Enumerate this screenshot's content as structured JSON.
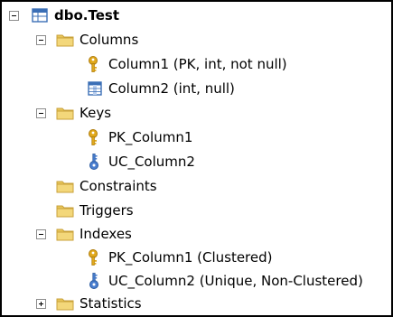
{
  "tree": {
    "table": {
      "label": "dbo.Test",
      "icon": "table-icon",
      "expanded": true
    },
    "columns_folder": {
      "label": "Columns",
      "icon": "folder-icon",
      "expanded": true
    },
    "columns": [
      {
        "label": "Column1 (PK, int, not null)",
        "icon": "primary-key-icon"
      },
      {
        "label": "Column2 (int, null)",
        "icon": "column-icon"
      }
    ],
    "keys_folder": {
      "label": "Keys",
      "icon": "folder-icon",
      "expanded": true
    },
    "keys": [
      {
        "label": "PK_Column1",
        "icon": "primary-key-icon"
      },
      {
        "label": "UC_Column2",
        "icon": "unique-key-icon"
      }
    ],
    "constraints_folder": {
      "label": "Constraints",
      "icon": "folder-icon"
    },
    "triggers_folder": {
      "label": "Triggers",
      "icon": "folder-icon"
    },
    "indexes_folder": {
      "label": "Indexes",
      "icon": "folder-icon",
      "expanded": true
    },
    "indexes": [
      {
        "label": "PK_Column1 (Clustered)",
        "icon": "primary-key-icon"
      },
      {
        "label": "UC_Column2 (Unique, Non-Clustered)",
        "icon": "unique-key-icon"
      }
    ],
    "statistics_folder": {
      "label": "Statistics",
      "icon": "folder-icon",
      "expanded": false
    }
  },
  "colors": {
    "folder": "#e8c55a",
    "folder_dark": "#c9a23a",
    "key": "#e0a81c",
    "table_blue": "#3b6fb6",
    "unique_blue": "#4b7fd0"
  }
}
